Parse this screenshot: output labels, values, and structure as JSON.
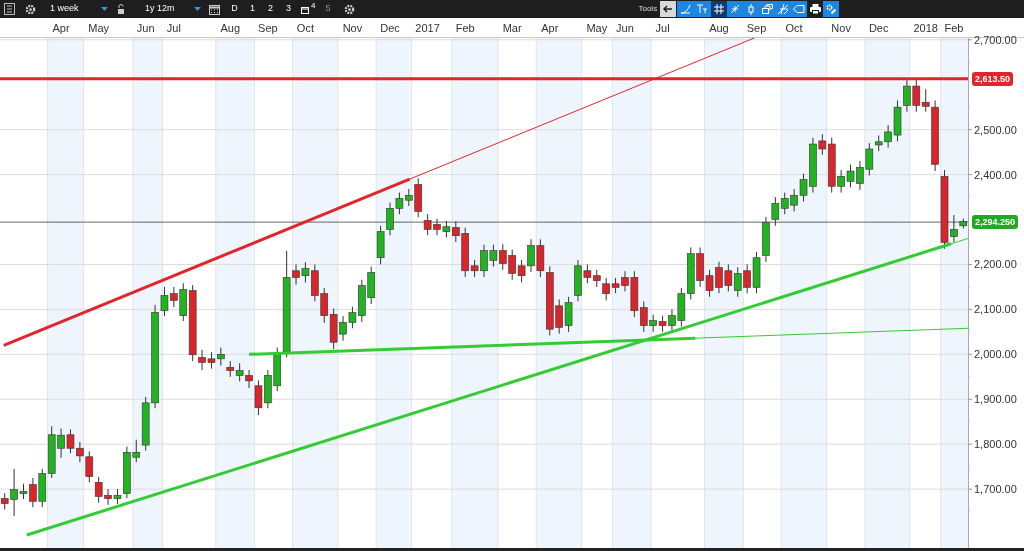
{
  "toolbar": {
    "interval": "1 week",
    "range": "1y 12m",
    "buttons": [
      {
        "kind": "text",
        "label": "D",
        "disabled": false
      },
      {
        "kind": "text",
        "label": "1",
        "disabled": false
      },
      {
        "kind": "text",
        "label": "2",
        "disabled": false
      },
      {
        "kind": "text",
        "label": "3",
        "disabled": false
      },
      {
        "kind": "window",
        "label": "4",
        "disabled": false
      },
      {
        "kind": "text",
        "label": "5",
        "disabled": true
      }
    ],
    "tools_label": "Tools"
  },
  "chart": {
    "chart_data": {
      "type": "candlestick",
      "grid": true,
      "categories": [
        null,
        null,
        null,
        null,
        null,
        null,
        "Apr",
        null,
        null,
        null,
        "May",
        null,
        null,
        null,
        null,
        "Jun",
        null,
        null,
        "Jul",
        null,
        null,
        null,
        null,
        null,
        "Aug",
        null,
        null,
        null,
        "Sep",
        null,
        null,
        null,
        "Oct",
        null,
        null,
        null,
        null,
        "Nov",
        null,
        null,
        null,
        "Dec",
        null,
        null,
        null,
        "2017",
        null,
        null,
        null,
        "Feb",
        null,
        null,
        null,
        null,
        "Mar",
        null,
        null,
        null,
        "Apr",
        null,
        null,
        null,
        null,
        "May",
        null,
        null,
        "Jun",
        null,
        null,
        null,
        "Jul",
        null,
        null,
        null,
        null,
        null,
        "Aug",
        null,
        null,
        null,
        "Sep",
        null,
        null,
        null,
        "Oct",
        null,
        null,
        null,
        null,
        "Nov",
        null,
        null,
        null,
        "Dec",
        null,
        null,
        null,
        null,
        "2018",
        null,
        null,
        "Feb",
        null
      ],
      "ylim": [
        1569,
        2704
      ],
      "yticks": [
        {
          "value": 2700,
          "label": "2,700.00"
        },
        {
          "value": 2500,
          "label": "2,500.00"
        },
        {
          "value": 2400,
          "label": "2,400.00"
        },
        {
          "value": 2200,
          "label": "2,200.00"
        },
        {
          "value": 2100,
          "label": "2,100.00"
        },
        {
          "value": 2000,
          "label": "2,000.00"
        },
        {
          "value": 1900,
          "label": "1,900.00"
        },
        {
          "value": 1800,
          "label": "1,800.00"
        },
        {
          "value": 1700,
          "label": "1,700.00"
        }
      ],
      "ohlc": [
        [
          1679,
          1691,
          1655,
          1668
        ],
        [
          1677,
          1745,
          1640,
          1699
        ],
        [
          1690,
          1712,
          1678,
          1695
        ],
        [
          1710,
          1725,
          1660,
          1673
        ],
        [
          1673,
          1745,
          1660,
          1735
        ],
        [
          1735,
          1840,
          1725,
          1821
        ],
        [
          1791,
          1835,
          1770,
          1820
        ],
        [
          1821,
          1833,
          1780,
          1791
        ],
        [
          1791,
          1805,
          1760,
          1774
        ],
        [
          1772,
          1784,
          1715,
          1728
        ],
        [
          1715,
          1727,
          1670,
          1684
        ],
        [
          1686,
          1700,
          1665,
          1679
        ],
        [
          1679,
          1700,
          1667,
          1686
        ],
        [
          1690,
          1795,
          1680,
          1782
        ],
        [
          1771,
          1810,
          1760,
          1782
        ],
        [
          1798,
          1905,
          1786,
          1892
        ],
        [
          1892,
          2110,
          1880,
          2093
        ],
        [
          2097,
          2150,
          2085,
          2131
        ],
        [
          2135,
          2150,
          2105,
          2120
        ],
        [
          2086,
          2158,
          2074,
          2144
        ],
        [
          2142,
          2154,
          1985,
          1999
        ],
        [
          1993,
          2010,
          1965,
          1982
        ],
        [
          1990,
          2005,
          1968,
          1982
        ],
        [
          1990,
          2015,
          1975,
          2000
        ],
        [
          1971,
          1985,
          1950,
          1964
        ],
        [
          1953,
          1980,
          1940,
          1964
        ],
        [
          1953,
          1965,
          1925,
          1941
        ],
        [
          1930,
          1942,
          1865,
          1881
        ],
        [
          1892,
          1965,
          1880,
          1953
        ],
        [
          1930,
          2015,
          1918,
          2000
        ],
        [
          2005,
          2230,
          1993,
          2171
        ],
        [
          2186,
          2200,
          2155,
          2171
        ],
        [
          2175,
          2205,
          2160,
          2191
        ],
        [
          2186,
          2200,
          2118,
          2131
        ],
        [
          2135,
          2148,
          2070,
          2086
        ],
        [
          2089,
          2102,
          2012,
          2027
        ],
        [
          2045,
          2085,
          2030,
          2071
        ],
        [
          2071,
          2106,
          2058,
          2093
        ],
        [
          2086,
          2166,
          2072,
          2153
        ],
        [
          2126,
          2195,
          2112,
          2182
        ],
        [
          2215,
          2286,
          2200,
          2273
        ],
        [
          2278,
          2338,
          2265,
          2325
        ],
        [
          2325,
          2360,
          2312,
          2347
        ],
        [
          2343,
          2368,
          2330,
          2354
        ],
        [
          2378,
          2392,
          2305,
          2318
        ],
        [
          2298,
          2312,
          2265,
          2278
        ],
        [
          2289,
          2302,
          2265,
          2278
        ],
        [
          2273,
          2297,
          2260,
          2284
        ],
        [
          2282,
          2296,
          2250,
          2264
        ],
        [
          2269,
          2282,
          2172,
          2186
        ],
        [
          2197,
          2210,
          2172,
          2186
        ],
        [
          2186,
          2244,
          2172,
          2231
        ],
        [
          2209,
          2244,
          2195,
          2231
        ],
        [
          2231,
          2245,
          2188,
          2202
        ],
        [
          2220,
          2233,
          2166,
          2180
        ],
        [
          2197,
          2210,
          2160,
          2175
        ],
        [
          2197,
          2256,
          2183,
          2242
        ],
        [
          2242,
          2256,
          2172,
          2186
        ],
        [
          2182,
          2196,
          2042,
          2056
        ],
        [
          2108,
          2122,
          2046,
          2060
        ],
        [
          2064,
          2128,
          2050,
          2115
        ],
        [
          2131,
          2210,
          2118,
          2197
        ],
        [
          2186,
          2200,
          2158,
          2171
        ],
        [
          2175,
          2188,
          2150,
          2164
        ],
        [
          2157,
          2170,
          2120,
          2135
        ],
        [
          2157,
          2170,
          2136,
          2149
        ],
        [
          2171,
          2185,
          2140,
          2153
        ],
        [
          2171,
          2185,
          2083,
          2097
        ],
        [
          2104,
          2118,
          2050,
          2064
        ],
        [
          2064,
          2088,
          2050,
          2075
        ],
        [
          2073,
          2086,
          2050,
          2064
        ],
        [
          2064,
          2100,
          2050,
          2086
        ],
        [
          2075,
          2148,
          2062,
          2135
        ],
        [
          2135,
          2238,
          2122,
          2224
        ],
        [
          2224,
          2238,
          2150,
          2164
        ],
        [
          2175,
          2188,
          2128,
          2142
        ],
        [
          2193,
          2206,
          2136,
          2149
        ],
        [
          2186,
          2200,
          2140,
          2153
        ],
        [
          2142,
          2194,
          2128,
          2180
        ],
        [
          2186,
          2200,
          2136,
          2149
        ],
        [
          2149,
          2228,
          2136,
          2215
        ],
        [
          2220,
          2306,
          2206,
          2293
        ],
        [
          2300,
          2350,
          2286,
          2336
        ],
        [
          2325,
          2360,
          2312,
          2347
        ],
        [
          2332,
          2368,
          2318,
          2354
        ],
        [
          2354,
          2402,
          2340,
          2389
        ],
        [
          2374,
          2482,
          2360,
          2468
        ],
        [
          2475,
          2490,
          2444,
          2457
        ],
        [
          2468,
          2482,
          2360,
          2374
        ],
        [
          2374,
          2410,
          2360,
          2396
        ],
        [
          2385,
          2422,
          2372,
          2408
        ],
        [
          2380,
          2430,
          2366,
          2416
        ],
        [
          2412,
          2470,
          2398,
          2457
        ],
        [
          2466,
          2487,
          2452,
          2473
        ],
        [
          2473,
          2510,
          2460,
          2495
        ],
        [
          2488,
          2565,
          2474,
          2550
        ],
        [
          2554,
          2612,
          2540,
          2597
        ],
        [
          2597,
          2612,
          2540,
          2554
        ],
        [
          2561,
          2590,
          2540,
          2552
        ],
        [
          2550,
          2565,
          2408,
          2423
        ],
        [
          2396,
          2410,
          2235,
          2249
        ],
        [
          2262,
          2310,
          2250,
          2278
        ],
        [
          2286,
          2302,
          2280,
          2296
        ]
      ],
      "ref_lines": [
        {
          "axis": "y",
          "value": 2613.5,
          "label": "2,613.50",
          "color": "#e0262b"
        },
        {
          "axis": "y",
          "value": 2294.25,
          "label": "2,294.250",
          "color": "#666666"
        }
      ]
    }
  }
}
